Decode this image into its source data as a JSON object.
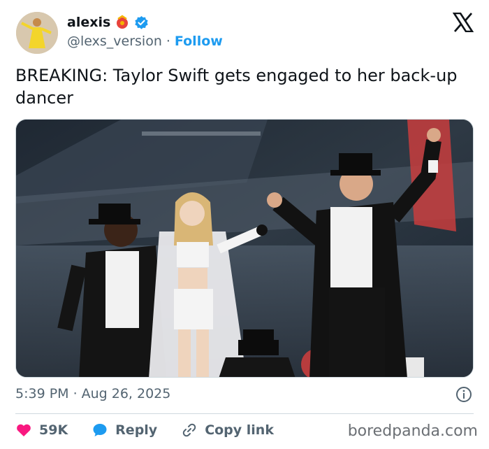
{
  "user": {
    "display_name": "alexis",
    "handle": "@lexs_version",
    "separator": "·",
    "follow_label": "Follow"
  },
  "tweet": {
    "text": "BREAKING: Taylor Swift gets engaged to her back-up dancer"
  },
  "meta": {
    "time": "5:39 PM",
    "separator": "·",
    "date": "Aug 26, 2025"
  },
  "actions": {
    "likes": "59K",
    "reply_label": "Reply",
    "copy_label": "Copy link"
  },
  "watermark": "boredpanda.com",
  "colors": {
    "accent": "#1d9bf0",
    "like": "#f91880",
    "muted": "#536471",
    "text": "#0f1419"
  },
  "icons": {
    "avatar": "avatar-image",
    "emoji": "clapper-emoji-icon",
    "verified": "verified-badge-icon",
    "brand": "x-logo-icon",
    "info": "info-icon",
    "like": "heart-icon",
    "reply": "speech-bubble-icon",
    "copy": "link-icon"
  }
}
